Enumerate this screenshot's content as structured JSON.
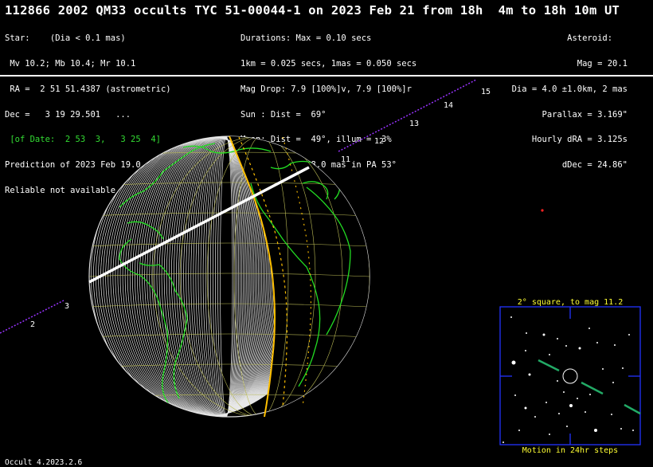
{
  "title": "112866 2002 QM33 occults TYC 51-00044-1 on 2023 Feb 21 from 18h  4m to 18h 10m UT",
  "star": {
    "line1": "Star:    (Dia < 0.1 mas)",
    "line2": " Mv 10.2; Mb 10.4; Mr 10.1",
    "line3": " RA =  2 51 51.4387 (astrometric)",
    "line4": "Dec =   3 19 29.501   ...",
    "line5": " [of Date:  2 53  3,   3 25  4]",
    "line6": "Prediction of 2023 Feb 19.0",
    "line7": "Reliable not available"
  },
  "event": {
    "line1": "Durations: Max = 0.10 secs",
    "line2": "1km = 0.025 secs, 1mas = 0.050 secs",
    "line3": "Mag Drop: 7.9 [100%]v, 7.9 [100%]r",
    "line4": "Sun : Dist =  69°",
    "line5": "Moon: Dist =  49°, illum =  3%",
    "line6": "Error 19.0 x 18.0 mas in PA 53°"
  },
  "asteroid": {
    "line1": "Asteroid:   ",
    "line2": "Mag = 20.1",
    "line3": "Dia = 4.0 ±1.0km, 2 mas",
    "line4": "Parallax = 3.169\"",
    "line5": "Hourly dRA = 3.125s",
    "line6": "dDec = 24.86\""
  },
  "track_ticks": [
    "2",
    "3",
    "11",
    "12",
    "13",
    "14",
    "15"
  ],
  "inset": {
    "title": "2° square, to mag 11.2",
    "footer": "Motion in 24hr steps"
  },
  "footer": "Occult 4.2023.2.6",
  "colors": {
    "background": "#000000",
    "globe_lines": "#ffffff",
    "land": "#22dd22",
    "shadow_edge": "#ffc000",
    "track": "#9933ff",
    "label_yellow": "#ffff33",
    "inset_frame": "#2233ff"
  }
}
